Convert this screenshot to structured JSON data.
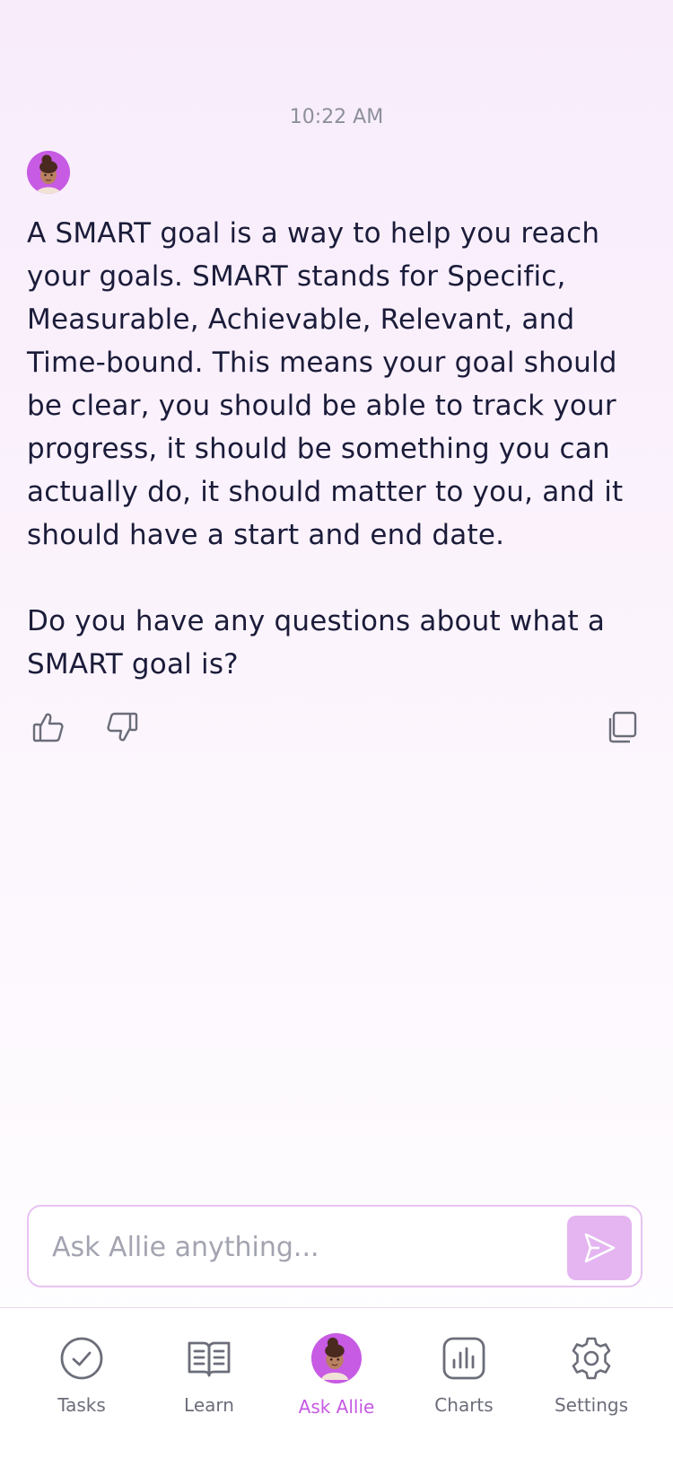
{
  "chat": {
    "timestamp": "10:22 AM",
    "message": {
      "paragraph1": "A SMART goal is a way to help you reach your goals. SMART stands for Specific, Measurable, Achievable, Relevant, and Time-bound. This means your goal should be clear, you should be able to track your progress, it should be something you can actually do, it should matter to you, and it should have a start and end date.",
      "paragraph2": "Do you have any questions about what a SMART goal is?"
    }
  },
  "composer": {
    "placeholder": "Ask Allie anything...",
    "value": ""
  },
  "tabs": [
    {
      "label": "Tasks",
      "icon": "check-circle-icon"
    },
    {
      "label": "Learn",
      "icon": "book-icon"
    },
    {
      "label": "Ask Allie",
      "icon": "allie-avatar",
      "active": true
    },
    {
      "label": "Charts",
      "icon": "bar-chart-icon"
    },
    {
      "label": "Settings",
      "icon": "gear-icon"
    }
  ],
  "colors": {
    "accent": "#c659e3",
    "send_button": "#e4b5f1",
    "text": "#1b1c3a",
    "muted": "#6b6d79"
  }
}
